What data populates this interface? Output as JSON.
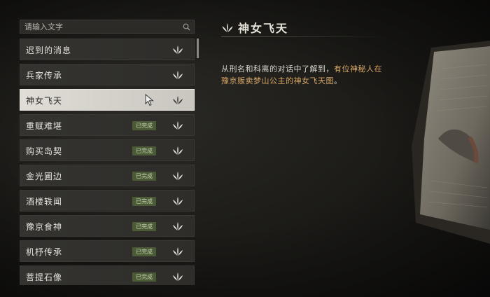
{
  "search": {
    "placeholder": "请输入文字"
  },
  "quests": [
    {
      "name": "迟到的消息",
      "status": ""
    },
    {
      "name": "兵家传承",
      "status": ""
    },
    {
      "name": "神女飞天",
      "status": ""
    },
    {
      "name": "重赋难堪",
      "status": "已完成"
    },
    {
      "name": "购买岛契",
      "status": "已完成"
    },
    {
      "name": "金光圃边",
      "status": "已完成"
    },
    {
      "name": "酒楼轶闻",
      "status": "已完成"
    },
    {
      "name": "豫京食神",
      "status": "已完成"
    },
    {
      "name": "机杼传承",
      "status": "已完成"
    },
    {
      "name": "菩提石像",
      "status": "已完成"
    }
  ],
  "detail": {
    "title": "神女飞天",
    "desc_part1": "从刑名和科离的对话中了解到，",
    "desc_highlight1": "有位神秘人在",
    "desc_highlight2": "豫京贩卖梦山公主的神女飞天图",
    "desc_part2": "。"
  },
  "colors": {
    "accent": "#d8a867",
    "badge_bg": "#4b5a37",
    "selected_bg": "#e0ddd6"
  },
  "icons": {
    "leaf": "leaf-icon",
    "search": "search-icon",
    "cursor": "mouse-cursor-icon"
  }
}
